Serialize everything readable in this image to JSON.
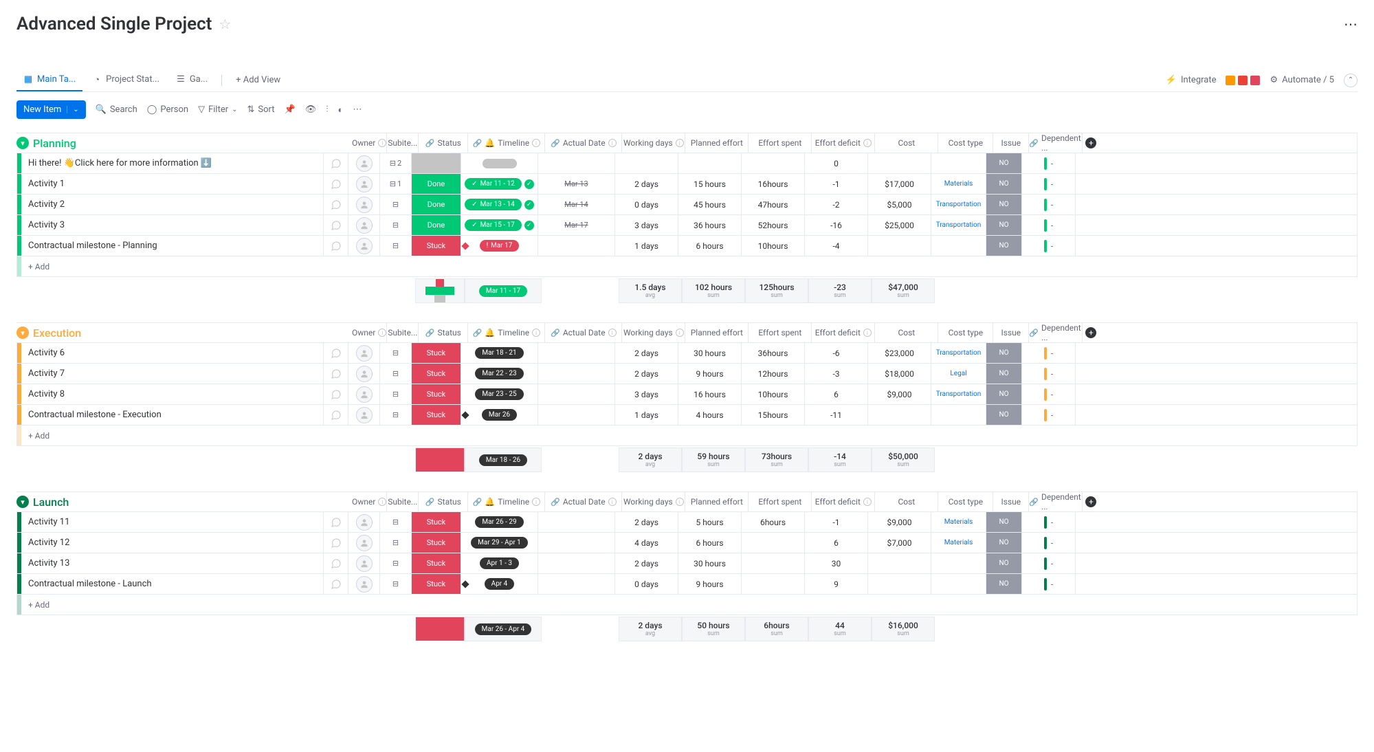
{
  "pageTitle": "Advanced Single Project",
  "tabs": [
    "Main Ta...",
    "Project Stat...",
    "Ga..."
  ],
  "addView": "+ Add View",
  "integrate": "Integrate",
  "automate": "Automate / 5",
  "newItem": "New Item",
  "toolbar": {
    "search": "Search",
    "person": "Person",
    "filter": "Filter",
    "sort": "Sort"
  },
  "columns": {
    "owner": "Owner",
    "subitems": "Subite...",
    "status": "Status",
    "timeline": "Timeline",
    "actual": "Actual Date",
    "working": "Working days",
    "planned": "Planned effort",
    "spent": "Effort spent",
    "deficit": "Effort deficit",
    "cost": "Cost",
    "costtype": "Cost type",
    "issue": "Issue",
    "dependent": "Dependent ..."
  },
  "addRow": "+ Add",
  "issueNo": "NO",
  "depDash": "-",
  "groups": [
    {
      "name": "Planning",
      "color": "#00c875",
      "rows": [
        {
          "name": "Hi there! 👋Click here for more information ⬇️",
          "sub": "2",
          "status": "",
          "timeline": "-",
          "tlStyle": "gray",
          "actual": "",
          "working": "",
          "planned": "",
          "spent": "",
          "deficit": "0",
          "cost": "",
          "costtype": "",
          "issue": "NO",
          "dep": "-"
        },
        {
          "name": "Activity 1",
          "sub": "1",
          "status": "Done",
          "timeline": "Mar 11 - 12",
          "tlStyle": "green",
          "check": true,
          "actual": "Mar 13",
          "strike": true,
          "working": "2 days",
          "planned": "15 hours",
          "spent": "16hours",
          "deficit": "-1",
          "cost": "$17,000",
          "costtype": "Materials",
          "issue": "NO",
          "dep": "-"
        },
        {
          "name": "Activity 2",
          "sub": "",
          "status": "Done",
          "timeline": "Mar 13 - 14",
          "tlStyle": "green",
          "check": true,
          "actual": "Mar 14",
          "strike": true,
          "working": "0 days",
          "planned": "45 hours",
          "spent": "47hours",
          "deficit": "-2",
          "cost": "$5,000",
          "costtype": "Transportation",
          "issue": "NO",
          "dep": "-"
        },
        {
          "name": "Activity 3",
          "sub": "",
          "status": "Done",
          "timeline": "Mar 15 - 17",
          "tlStyle": "green",
          "check": true,
          "actual": "Mar 17",
          "strike": true,
          "working": "3 days",
          "planned": "36 hours",
          "spent": "52hours",
          "deficit": "-16",
          "cost": "$25,000",
          "costtype": "Transportation",
          "issue": "NO",
          "dep": "-"
        },
        {
          "name": "Contractual milestone - Planning",
          "sub": "",
          "status": "Stuck",
          "timeline": "Mar 17",
          "tlStyle": "stuck",
          "diamond": "#e2445c",
          "actual": "",
          "working": "1 days",
          "planned": "6 hours",
          "spent": "10hours",
          "deficit": "-4",
          "cost": "",
          "costtype": "",
          "issue": "NO",
          "dep": "-"
        }
      ],
      "summary": {
        "statusSegs": [
          {
            "c": "#e2445c",
            "w": "18"
          },
          {
            "c": "#00c875",
            "w": "60"
          },
          {
            "c": "#c4c4c4",
            "w": "22"
          }
        ],
        "timeline": "Mar 11 - 17",
        "tlColor": "#00c875",
        "working": "1.5 days",
        "planned": "102 hours",
        "spent": "125hours",
        "deficit": "-23",
        "cost": "$47,000"
      }
    },
    {
      "name": "Execution",
      "color": "#fdab3d",
      "rows": [
        {
          "name": "Activity 6",
          "sub": "",
          "status": "Stuck",
          "timeline": "Mar 18 - 21",
          "tlStyle": "dark",
          "actual": "",
          "working": "2 days",
          "planned": "30 hours",
          "spent": "36hours",
          "deficit": "-6",
          "cost": "$23,000",
          "costtype": "Transportation",
          "issue": "NO",
          "dep": "-"
        },
        {
          "name": "Activity 7",
          "sub": "",
          "status": "Stuck",
          "timeline": "Mar 22 - 23",
          "tlStyle": "dark",
          "actual": "",
          "working": "2 days",
          "planned": "9 hours",
          "spent": "12hours",
          "deficit": "-3",
          "cost": "$18,000",
          "costtype": "Legal",
          "issue": "NO",
          "dep": "-"
        },
        {
          "name": "Activity 8",
          "sub": "",
          "status": "Stuck",
          "timeline": "Mar 23 - 25",
          "tlStyle": "dark",
          "actual": "",
          "working": "3 days",
          "planned": "16 hours",
          "spent": "10hours",
          "deficit": "6",
          "cost": "$9,000",
          "costtype": "Transportation",
          "issue": "NO",
          "dep": "-"
        },
        {
          "name": "Contractual milestone - Execution",
          "sub": "",
          "status": "Stuck",
          "timeline": "Mar 26",
          "tlStyle": "dark",
          "diamond": "#333",
          "actual": "",
          "working": "1 days",
          "planned": "4 hours",
          "spent": "15hours",
          "deficit": "-11",
          "cost": "",
          "costtype": "",
          "issue": "NO",
          "dep": "-"
        }
      ],
      "summary": {
        "statusSegs": [
          {
            "c": "#e2445c",
            "w": "100"
          }
        ],
        "timeline": "Mar 18 - 26",
        "tlColor": "#333",
        "working": "2 days",
        "planned": "59 hours",
        "spent": "73hours",
        "deficit": "-14",
        "cost": "$50,000"
      }
    },
    {
      "name": "Launch",
      "color": "#037f4c",
      "rows": [
        {
          "name": "Activity 11",
          "sub": "",
          "status": "Stuck",
          "timeline": "Mar 26 - 29",
          "tlStyle": "dark",
          "actual": "",
          "working": "2 days",
          "planned": "5 hours",
          "spent": "6hours",
          "deficit": "-1",
          "cost": "$9,000",
          "costtype": "Materials",
          "issue": "NO",
          "dep": "-"
        },
        {
          "name": "Activity 12",
          "sub": "",
          "status": "Stuck",
          "timeline": "Mar 29 - Apr 1",
          "tlStyle": "dark",
          "actual": "",
          "working": "4 days",
          "planned": "6 hours",
          "spent": "",
          "deficit": "6",
          "cost": "$7,000",
          "costtype": "Materials",
          "issue": "NO",
          "dep": "-"
        },
        {
          "name": "Activity 13",
          "sub": "",
          "status": "Stuck",
          "timeline": "Apr 1 - 3",
          "tlStyle": "dark",
          "actual": "",
          "working": "2 days",
          "planned": "30 hours",
          "spent": "",
          "deficit": "30",
          "cost": "",
          "costtype": "",
          "issue": "NO",
          "dep": "-"
        },
        {
          "name": "Contractual milestone - Launch",
          "sub": "",
          "status": "Stuck",
          "timeline": "Apr 4",
          "tlStyle": "dark",
          "diamond": "#333",
          "actual": "",
          "working": "0 days",
          "planned": "9 hours",
          "spent": "",
          "deficit": "9",
          "cost": "",
          "costtype": "",
          "issue": "NO",
          "dep": "-"
        }
      ],
      "summary": {
        "statusSegs": [
          {
            "c": "#e2445c",
            "w": "100"
          }
        ],
        "timeline": "Mar 26 - Apr 4",
        "tlColor": "#333",
        "working": "2 days",
        "planned": "50 hours",
        "spent": "6hours",
        "deficit": "44",
        "cost": "$16,000"
      }
    }
  ],
  "sumSub": {
    "avg": "avg",
    "sum": "sum"
  }
}
